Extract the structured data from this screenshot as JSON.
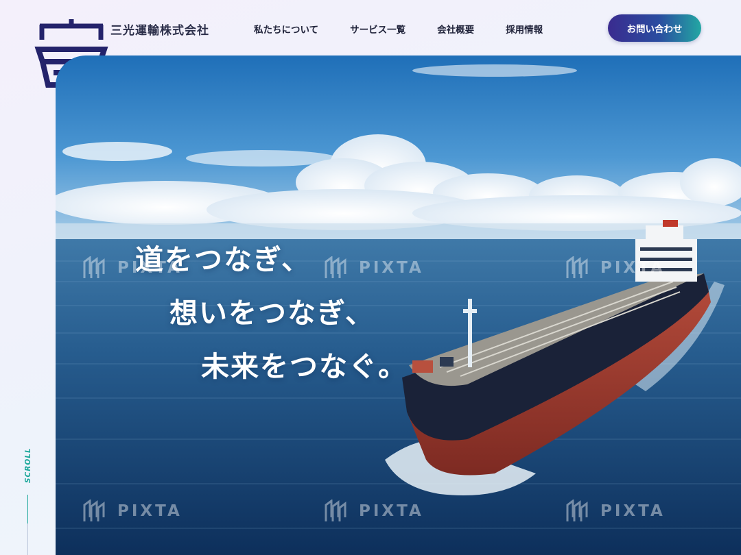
{
  "brand": {
    "company_name": "三光運輸株式会社",
    "logo_color": "#24236b"
  },
  "nav": {
    "items": [
      "私たちについて",
      "サービス一覧",
      "会社概要",
      "採用情報"
    ]
  },
  "contact_button": {
    "label": "お問い合わせ"
  },
  "hero": {
    "headline": [
      "道をつなぎ、",
      "想いをつなぎ、",
      "未来をつなぐ。"
    ],
    "watermark": "PIXTA"
  },
  "scroll_indicator": {
    "label": "SCROLL",
    "accent_color": "#1ba79a"
  },
  "colors": {
    "button_gradient_start": "#3a2b8f",
    "button_gradient_end": "#23a7a3"
  }
}
